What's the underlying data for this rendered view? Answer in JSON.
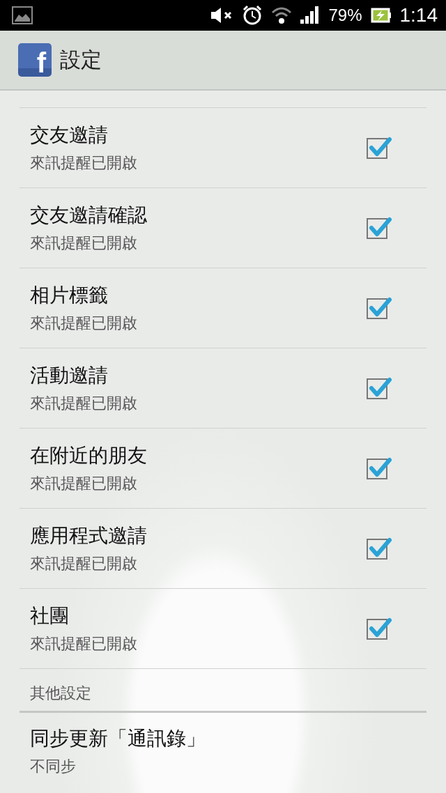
{
  "status_bar": {
    "battery": "79%",
    "time": "1:14"
  },
  "action_bar": {
    "app_icon_letter": "f",
    "title": "設定"
  },
  "settings": [
    {
      "title": "交友邀請",
      "summary": "來訊提醒已開啟",
      "checked": true
    },
    {
      "title": "交友邀請確認",
      "summary": "來訊提醒已開啟",
      "checked": true
    },
    {
      "title": "相片標籤",
      "summary": "來訊提醒已開啟",
      "checked": true
    },
    {
      "title": "活動邀請",
      "summary": "來訊提醒已開啟",
      "checked": true
    },
    {
      "title": "在附近的朋友",
      "summary": "來訊提醒已開啟",
      "checked": true
    },
    {
      "title": "應用程式邀請",
      "summary": "來訊提醒已開啟",
      "checked": true
    },
    {
      "title": "社團",
      "summary": "來訊提醒已開啟",
      "checked": true
    }
  ],
  "other_section": {
    "header": "其他設定",
    "items": [
      {
        "title": "同步更新「通訊錄」",
        "summary": "不同步"
      }
    ]
  }
}
